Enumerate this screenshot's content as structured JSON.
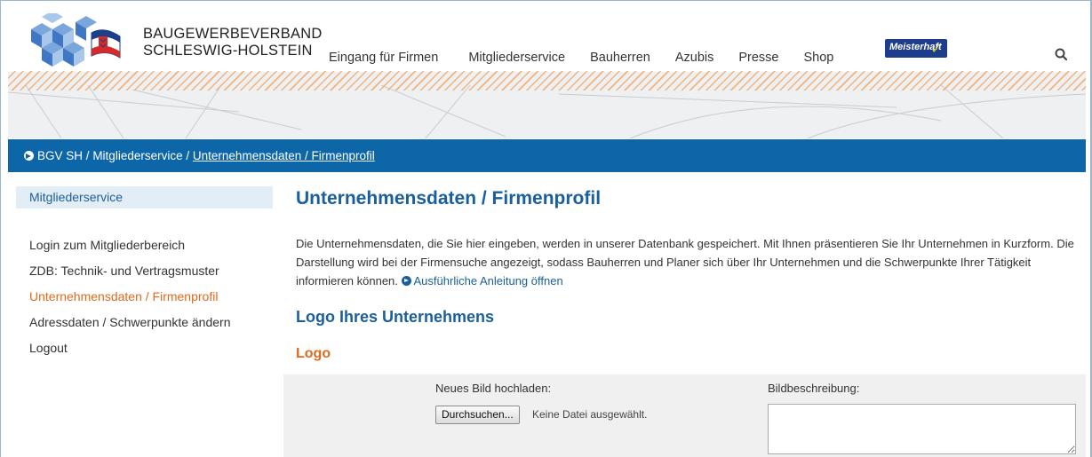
{
  "brand": {
    "line1": "BAUGEWERBEVERBAND",
    "line2": "SCHLESWIG-HOLSTEIN",
    "badge_text": "Meisterhaft",
    "colors": {
      "primary_blue": "#0d66a8",
      "heading_blue": "#1a5f9c",
      "accent_orange": "#e06a1c"
    }
  },
  "nav": {
    "items": [
      "Eingang für Firmen",
      "Mitgliederservice",
      "Bauherren",
      "Azubis",
      "Presse",
      "Shop"
    ],
    "search_icon": "search-icon"
  },
  "breadcrumb": {
    "root": "BGV SH",
    "sep": "/",
    "parent": "Mitgliederservice",
    "current": "Unternehmensdaten / Firmenprofil"
  },
  "sidebar": {
    "heading": "Mitgliederservice",
    "items": [
      {
        "label": "Login zum Mitgliederbereich",
        "active": false
      },
      {
        "label": "ZDB: Technik- und Vertragsmuster",
        "active": false
      },
      {
        "label": "Unternehmensdaten / Firmenprofil",
        "active": true
      },
      {
        "label": "Adressdaten / Schwerpunkte ändern",
        "active": false
      },
      {
        "label": "Logout",
        "active": false
      }
    ]
  },
  "main": {
    "title": "Unternehmensdaten / Firmenprofil",
    "intro": "Die Unternehmensdaten, die Sie hier eingeben, werden in unserer Datenbank gespeichert. Mit Ihnen präsentieren Sie Ihr Unternehmen in Kurzform. Die Darstellung wird bei der Firmensuche angezeigt, sodass Bauherren und Planer sich über Ihr Unternehmen und die Schwerpunkte Ihrer Tätigkeit informieren können. ",
    "guide_link": "Ausführliche Anleitung öffnen",
    "section_title": "Logo Ihres Unternehmens",
    "subsection_title": "Logo"
  },
  "form": {
    "upload_label": "Neues Bild hochladen:",
    "browse_button": "Durchsuchen...",
    "no_file": "Keine Datei ausgewählt.",
    "description_label": "Bildbeschreibung:",
    "description_value": ""
  }
}
